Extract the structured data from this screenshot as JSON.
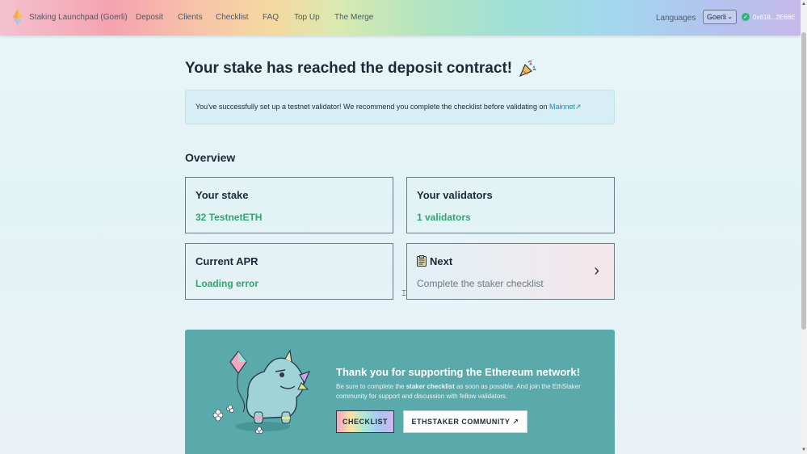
{
  "header": {
    "brand": "Staking Launchpad (Goerli)",
    "nav": [
      "Deposit",
      "Clients",
      "Checklist",
      "FAQ",
      "Top Up",
      "The Merge"
    ],
    "languages": "Languages",
    "network": "Goerli",
    "wallet_address": "0x618...2E68E"
  },
  "main": {
    "title": "Your stake has reached the deposit contract!",
    "alert_text": "You've successfully set up a testnet validator! We recommend you complete the checklist before validating on",
    "alert_link": "Mainnet",
    "alert_link_arrow": "↗",
    "overview": "Overview",
    "cards": {
      "stake_label": "Your stake",
      "stake_value": "32 TestnetETH",
      "validators_label": "Your validators",
      "validators_value": "1 validators",
      "apr_label": "Current APR",
      "apr_value": "Loading error",
      "next_label": "Next",
      "next_sub": "Complete the staker checklist",
      "next_arrow": "›"
    }
  },
  "banner": {
    "heading": "Thank you for supporting the Ethereum network!",
    "body_prefix": "Be sure to complete the",
    "body_bold": "staker checklist",
    "body_suffix": "as soon as possible. And join the EthStaker community for support and discussion with fellow validators.",
    "checklist_button": "CHECKLIST",
    "ethstaker_button": "ETHSTAKER COMMUNITY",
    "ethstaker_arrow": "↗"
  },
  "icons": {
    "logo": "ethereum-logo-icon",
    "party": "party-popper-icon",
    "clipboard": "clipboard-icon",
    "chevron": "chevron-right-icon",
    "wallet_status": "check-circle-icon"
  },
  "colors": {
    "accent_green": "#2fa66b",
    "banner_bg": "#5aa9ab",
    "link": "#2a8aa5"
  }
}
